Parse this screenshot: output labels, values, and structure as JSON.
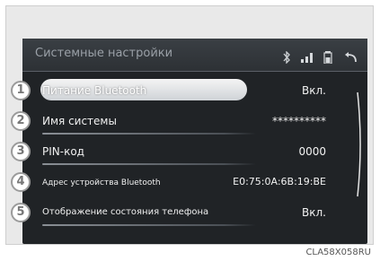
{
  "header": {
    "title": "Системные настройки",
    "icons": [
      "bluetooth-icon",
      "signal-icon",
      "battery-icon",
      "back-icon"
    ]
  },
  "rows": [
    {
      "num": "1",
      "label": "Питание Bluetooth",
      "value": "Вкл."
    },
    {
      "num": "2",
      "label": "Имя системы",
      "value": "**********"
    },
    {
      "num": "3",
      "label": "PIN-код",
      "value": "0000"
    },
    {
      "num": "4",
      "label": "Адрес устройства Bluetooth",
      "value": "E0:75:0A:6B:19:BE"
    },
    {
      "num": "5",
      "label": "Отображение состояния телефона",
      "value": "Вкл."
    }
  ],
  "caption": "CLA58X058RU"
}
